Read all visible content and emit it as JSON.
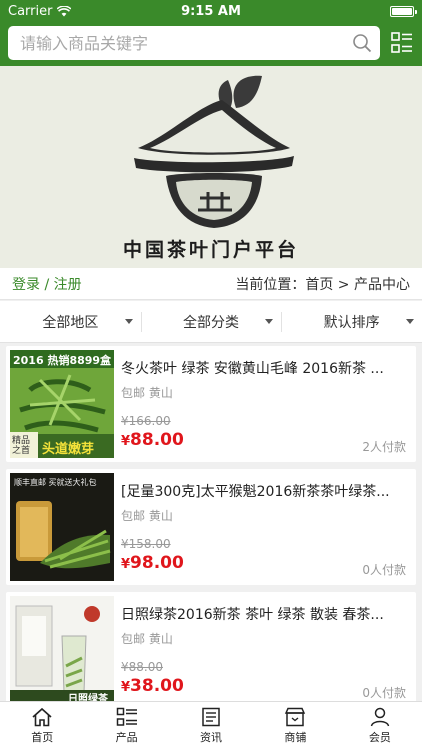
{
  "status": {
    "carrier": "Carrier",
    "time": "9:15 AM",
    "battery_level": 0.9
  },
  "search": {
    "placeholder": "请输入商品关键字"
  },
  "banner": {
    "title": "中国茶叶门户平台"
  },
  "location_bar": {
    "login": "登录",
    "separator": "/",
    "register": "注册",
    "breadcrumb": "当前位置：首页 > 产品中心"
  },
  "filters": [
    {
      "label": "全部地区"
    },
    {
      "label": "全部分类"
    },
    {
      "label": "默认排序"
    }
  ],
  "products": [
    {
      "name": "冬火茶叶 绿茶 安徽黄山毛峰 2016新茶 ...",
      "location": "包邮 黄山",
      "old_price": "¥166.00",
      "currency": "¥",
      "price": "88.00",
      "sold": "2人付款",
      "thumb_caption": "2016 热销8899盒",
      "thumb_tag": "头道嫩芽",
      "thumb_tag2": "精品之首"
    },
    {
      "name": "[足量300克]太平猴魁2016新茶茶叶绿茶...",
      "location": "包邮 黄山",
      "old_price": "¥158.00",
      "currency": "¥",
      "price": "98.00",
      "sold": "0人付款",
      "thumb_caption": "顺丰直邮 买就送大礼包"
    },
    {
      "name": "日照绿茶2016新茶 茶叶 绿茶 散装 春茶...",
      "location": "包邮 黄山",
      "old_price": "¥88.00",
      "currency": "¥",
      "price": "38.00",
      "sold": "0人付款",
      "thumb_tag": "日照绿茶"
    }
  ],
  "tabbar": [
    {
      "label": "首页",
      "icon": "home-icon"
    },
    {
      "label": "产品",
      "icon": "grid-list-icon"
    },
    {
      "label": "资讯",
      "icon": "news-icon"
    },
    {
      "label": "商铺",
      "icon": "shop-icon"
    },
    {
      "label": "会员",
      "icon": "user-icon"
    }
  ],
  "colors": {
    "brand_green": "#3a8a2a",
    "price_red": "#e0161c"
  }
}
